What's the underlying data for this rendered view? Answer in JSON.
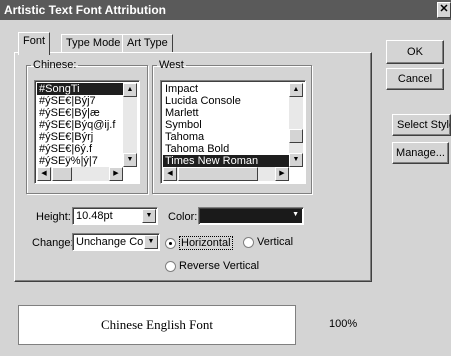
{
  "window": {
    "title": "Artistic Text Font Attribution",
    "close_glyph": "✕"
  },
  "tabs": [
    {
      "label": "Font",
      "active": true
    },
    {
      "label": "Type Mode",
      "active": false
    },
    {
      "label": "Art Type",
      "active": false
    }
  ],
  "buttons": {
    "ok": "OK",
    "cancel": "Cancel",
    "select_style": "Select Style",
    "manage": "Manage..."
  },
  "chinese": {
    "legend": "Chinese:",
    "items": [
      "#SongTi",
      "#ýSE€|Býj7",
      "#ýSE€|Bý|æ",
      "#ýSE€|Býq@ij.f",
      "#ýSE€|Býrj",
      "#ýSE€|6ý.f",
      "#ýSEÿ%|ý|7"
    ],
    "selected_index": 0
  },
  "west": {
    "legend": "West",
    "items": [
      "Impact",
      "Lucida Console",
      "Marlett",
      "Symbol",
      "Tahoma",
      "Tahoma Bold",
      "Times New Roman"
    ],
    "selected_index": 6
  },
  "height": {
    "label": "Height:",
    "value": "10.48pt"
  },
  "color": {
    "label": "Color:",
    "value": "#1a1a1a"
  },
  "change": {
    "label": "Change:",
    "value": "Unchange Coc"
  },
  "orientation": {
    "horizontal": "Horizontal",
    "vertical": "Vertical",
    "reverse_vertical": "Reverse Vertical",
    "selected": "horizontal"
  },
  "preview": {
    "text": "Chinese English Font",
    "zoom": "100%"
  },
  "icons": {
    "arrow_up": "up-arrow-icon",
    "arrow_down": "down-arrow-icon",
    "arrow_left": "left-arrow-icon",
    "arrow_right": "right-arrow-icon"
  }
}
